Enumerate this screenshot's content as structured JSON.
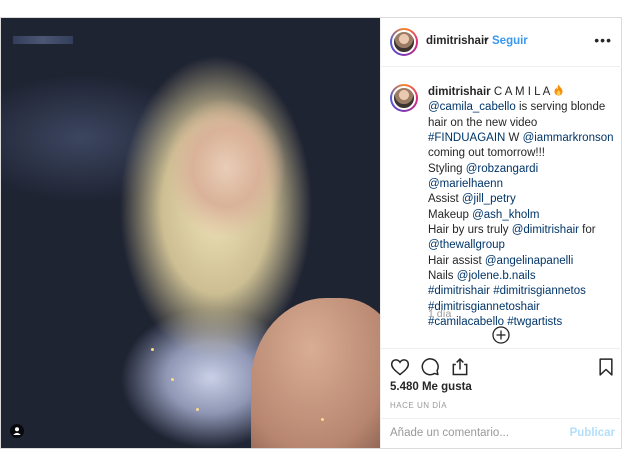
{
  "post": {
    "username": "dimitrishair",
    "dot": "•",
    "follow_label": "Seguir",
    "more_label": "•••"
  },
  "caption": {
    "username": "dimitrishair",
    "title": "C A M I L A",
    "title_emoji": "fire-icon",
    "lines": [
      {
        "parts": [
          {
            "text": "@camila_cabello",
            "link": true
          },
          {
            "text": " is serving blonde",
            "link": false
          }
        ]
      },
      {
        "parts": [
          {
            "text": "hair on the new video",
            "link": false
          }
        ]
      },
      {
        "parts": [
          {
            "text": "#FINDUAGAIN",
            "link": true
          },
          {
            "text": " W ",
            "link": false
          },
          {
            "text": "@iammarkronson",
            "link": true
          }
        ]
      },
      {
        "parts": [
          {
            "text": "coming out tomorrow!!!",
            "link": false
          }
        ]
      },
      {
        "parts": [
          {
            "text": "Styling ",
            "link": false
          },
          {
            "text": "@robzangardi",
            "link": true
          }
        ]
      },
      {
        "parts": [
          {
            "text": "@marielhaenn",
            "link": true
          }
        ]
      },
      {
        "parts": [
          {
            "text": "Assist ",
            "link": false
          },
          {
            "text": "@jill_petry",
            "link": true
          }
        ]
      },
      {
        "parts": [
          {
            "text": "Makeup ",
            "link": false
          },
          {
            "text": "@ash_kholm",
            "link": true
          }
        ]
      },
      {
        "parts": [
          {
            "text": "Hair by urs truly ",
            "link": false
          },
          {
            "text": "@dimitrishair",
            "link": true
          },
          {
            "text": " for",
            "link": false
          }
        ]
      },
      {
        "parts": [
          {
            "text": "@thewallgroup",
            "link": true
          }
        ]
      },
      {
        "parts": [
          {
            "text": "Hair assist ",
            "link": false
          },
          {
            "text": "@angelinapanelli",
            "link": true
          }
        ]
      },
      {
        "parts": [
          {
            "text": "Nails ",
            "link": false
          },
          {
            "text": "@jolene.b.nails",
            "link": true
          }
        ]
      },
      {
        "parts": [
          {
            "text": "#dimitrishair",
            "link": true
          },
          {
            "text": " ",
            "link": false
          },
          {
            "text": "#dimitrisgiannetos",
            "link": true
          }
        ]
      },
      {
        "parts": [
          {
            "text": "#dimitrisgiannetoshair",
            "link": true
          }
        ]
      },
      {
        "parts": [
          {
            "text": "#camilacabello",
            "link": true
          },
          {
            "text": " ",
            "link": false
          },
          {
            "text": "#twgartists",
            "link": true
          }
        ]
      }
    ],
    "time": "1 día"
  },
  "actions": {
    "icons": [
      "heart-icon",
      "comment-icon",
      "share-icon",
      "bookmark-icon"
    ],
    "likes": "5.480 Me gusta",
    "ago": "HACE UN DÍA"
  },
  "comment": {
    "placeholder": "Añade un comentario...",
    "publish_label": "Publicar"
  },
  "colors": {
    "link": "#003569",
    "follow": "#3897f0",
    "muted": "#999999",
    "publish_disabled": "#b2dffc",
    "border": "#dbdbdb"
  }
}
